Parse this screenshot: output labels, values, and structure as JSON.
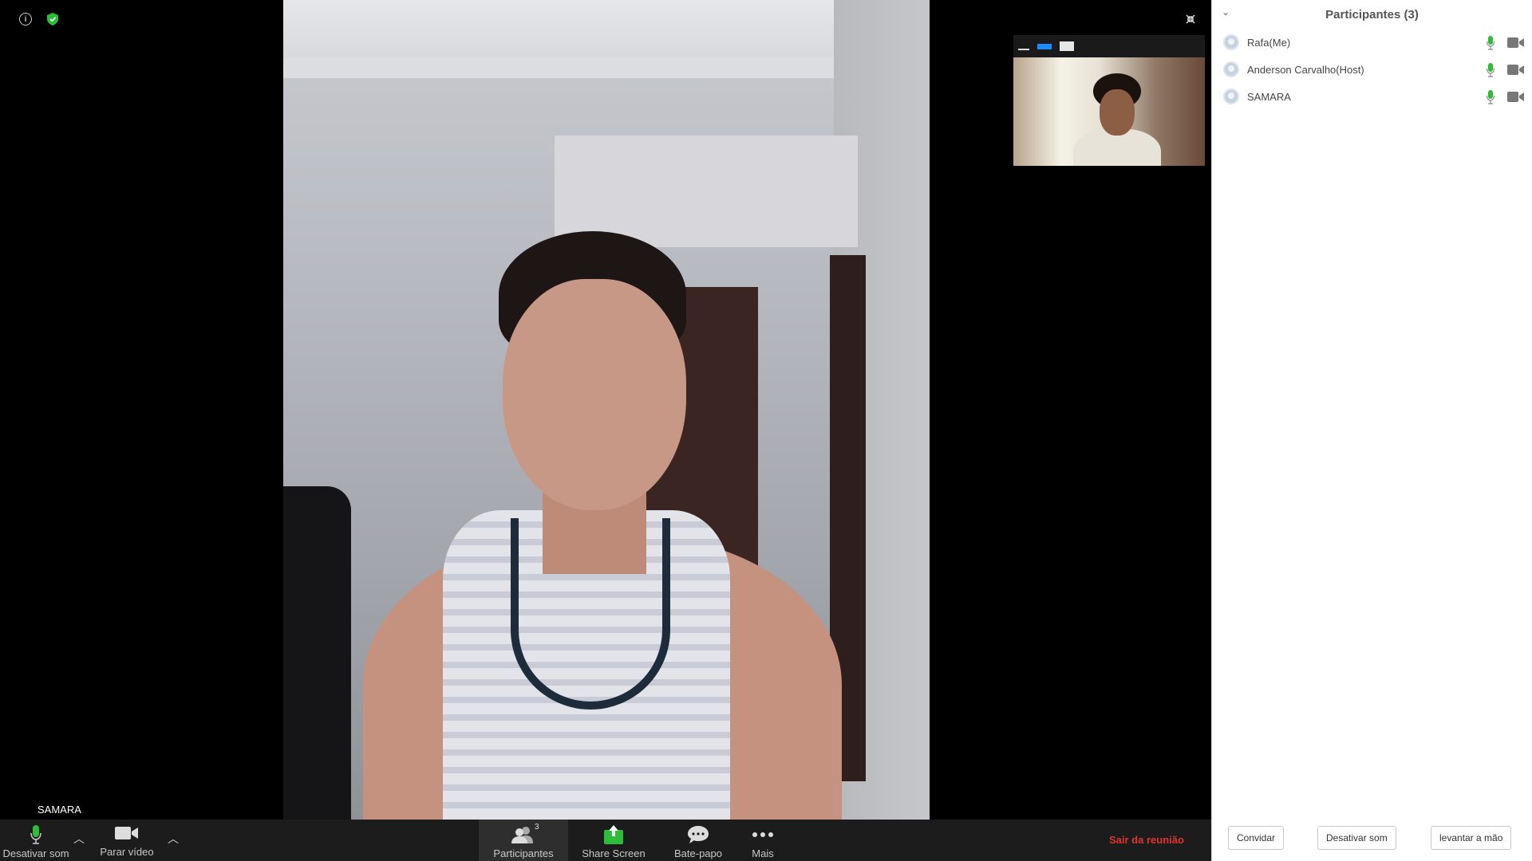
{
  "main_video": {
    "name_label": "SAMARA"
  },
  "toolbar": {
    "mute_label": "Desativar som",
    "video_label": "Parar vídeo",
    "participants_label": "Participantes",
    "participants_count": "3",
    "share_label": "Share Screen",
    "chat_label": "Bate-papo",
    "more_label": "Mais",
    "leave_label": "Sair da reunião"
  },
  "panel": {
    "title": "Participantes (3)",
    "participants": [
      {
        "name": "Rafa(Me)"
      },
      {
        "name": "Anderson Carvalho(Host)"
      },
      {
        "name": "SAMARA"
      }
    ],
    "invite_label": "Convidar",
    "mute_all_label": "Desativar som",
    "raise_hand_label": "levantar a mão"
  },
  "colors": {
    "accent_green": "#2dbd3a",
    "leave_red": "#e0332f",
    "thumb_selected_blue": "#1a8cff"
  },
  "icons": [
    "info-icon",
    "shield-icon",
    "exit-fullscreen-icon",
    "microphone-icon",
    "camera-icon",
    "participants-icon",
    "share-screen-icon",
    "chat-icon",
    "more-icon"
  ]
}
